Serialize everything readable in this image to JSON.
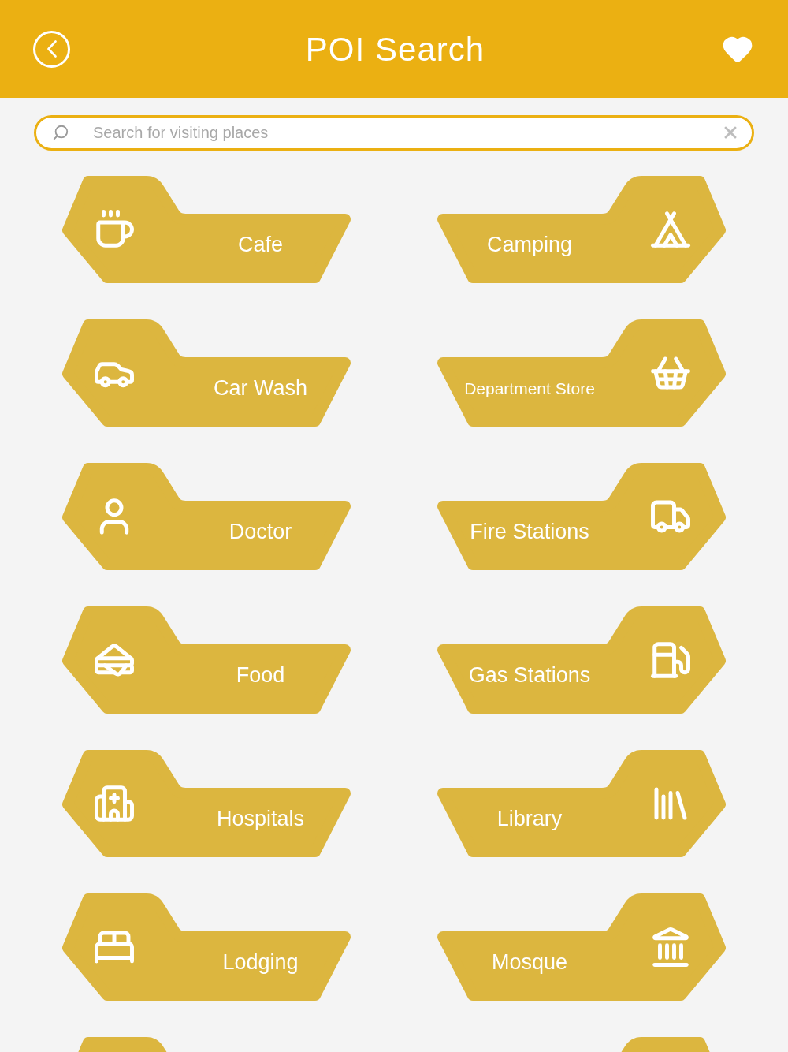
{
  "header": {
    "title": "POI Search"
  },
  "search": {
    "placeholder": "Search for visiting places"
  },
  "tiles": [
    {
      "kind": "full",
      "label": "Cafe"
    },
    {
      "kind": "full",
      "label": "Camping"
    },
    {
      "kind": "full",
      "label": "Car Wash"
    },
    {
      "kind": "full",
      "label": "Department Store"
    },
    {
      "kind": "full",
      "label": "Doctor"
    },
    {
      "kind": "full",
      "label": "Fire Stations"
    },
    {
      "kind": "full",
      "label": "Food"
    },
    {
      "kind": "full",
      "label": "Gas Stations"
    },
    {
      "kind": "full",
      "label": "Hospitals"
    },
    {
      "kind": "full",
      "label": "Library"
    },
    {
      "kind": "full",
      "label": "Lodging"
    },
    {
      "kind": "full",
      "label": "Mosque"
    },
    {
      "kind": "cut"
    },
    {
      "kind": "cut"
    }
  ]
}
